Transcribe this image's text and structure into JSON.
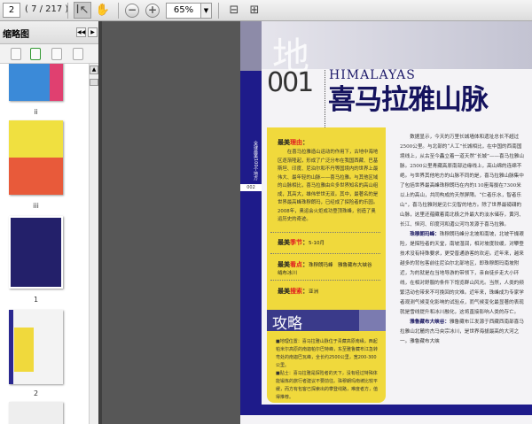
{
  "toolbar": {
    "page_input": "2",
    "page_count": "( 7 / 217 )",
    "zoom": "65%",
    "icons": [
      "select-tool-icon",
      "hand-tool-icon",
      "zoom-out-icon",
      "zoom-in-icon",
      "fit-width-icon",
      "fit-page-icon"
    ]
  },
  "sidebar": {
    "title": "缩略图",
    "thumbnails": [
      {
        "label": "ii"
      },
      {
        "label": "iii"
      },
      {
        "label": "1"
      },
      {
        "label": "2"
      }
    ]
  },
  "page": {
    "side_label": "全球最美100个地方",
    "page_number": "002",
    "big_char": "地",
    "number": "001",
    "english_title": "HIMALAYAS",
    "title": "喜马拉雅山脉",
    "reason_prefix": "最美",
    "reason_key": "理由",
    "reason_text": "在喜马拉雅造山运动的作用下，古地中海地区逐渐隆起，形成了广泛分布在我国西藏、巴基斯坦、印度、尼泊尔和不丹等国境内的世界上最伟大、最年轻的山脉——喜马拉雅。与其他区域的山脉相比，喜马拉雅由众多世界知名的高山组成，其高大，雄伟举世无双。其中，最著名的是世界最高峰珠穆朗玛，已经成了探险者的乐园。2008年，奥运会火炬成功登顶珠峰，创造了奥运历史的奇迹。",
    "season_prefix": "最美",
    "season_key": "季节",
    "season_value": "5-10月",
    "sight_prefix": "最美",
    "sight_key": "看点",
    "sight_value": "珠穆朗玛峰　雅鲁藏布大峡谷　绒布冰川",
    "search_prefix": "最美",
    "search_key": "搜索",
    "search_value": "亚洲",
    "guide_title": "攻略",
    "guide_location": "■地理位置：喜马拉雅山脉位于青藏高原南缘，西起帕米尔高原的南迦帕尔巴特峰，东至雅鲁藏布江急转弯处的南迦巴瓦峰，全长约2500公里，宽200-300公里。",
    "guide_tips": "■贴士：喜马拉雅是探险者的天下，没有经过特殊体能锻炼的旅行者建议不要前往。珠穆朗玛南坡比较平缓，而方有包客已探索出的攀登线路，难度者方，值得推荐。",
    "body_p1": "数据显示，今天的万里长城墙体和遗址总长不超过2500公里。与北部的“人工”长城相比，在中国的西南国境线上，从古至今矗立着一道天然“长城”——喜马拉雅山脉。2500公里青藏高原南部边缘线上，高山绵的连绵不绝。与世界其他地方的山脉不同的是，喜马拉雅山脉集中了包括世界最高峰珠穆朗玛在内的110座海拔在7300米以上的高山，共同构成的天然屏障。“仁者乐水，智者乐山”，喜马拉雅则是见仁见智的地方。除了世界最磅礴的山脉，这里还蕴藏着南北极之外最大的淡水储存，黄河、长江、恒河、印度河和湄公河均发源于喜马拉雅。",
    "body_p2_head": "珠穆朗玛峰：",
    "body_p2": "珠穆朗玛峰分北坡和南坡，北坡干燥艰险，是探险者的天堂，南坡湿润，相对坡度较缓，对攀登技术没有特殊要求，更受普通游客的欢迎。近年来，越来越多的背包客前往尼泊尔北部地区，即珠穆朗玛南坡附近，为的就是在当地导游的带领下，亲自徒步走大小环线，在相对舒服的条件下饱览群山风光。当然，人类的频繁活动也带来不可挽回的灾难。近年来，珠峰成为专家学者观测气候变化影响的试验点，而气候变化最显著的表现就是雪线提升和冰川融化，这将直接影响人类的存亡。",
    "body_p3_head": "雅鲁藏布大峡谷：",
    "body_p3": "雅鲁藏布江发源于西藏西南部喜马拉雅山北麓的杰马央宗冰川，是世界海拔最高的大河之一。雅鲁藏布大峡"
  }
}
